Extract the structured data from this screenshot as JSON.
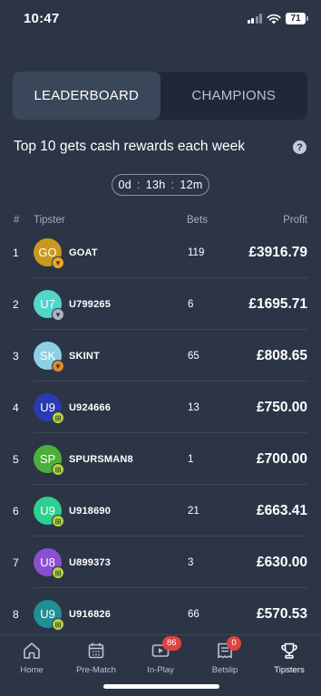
{
  "status_bar": {
    "time": "10:47",
    "battery": "71"
  },
  "tabs_segment": {
    "leaderboard": "LEADERBOARD",
    "champions": "CHAMPIONS"
  },
  "promo_text": "Top 10 gets cash rewards each week",
  "help_icon_glyph": "?",
  "countdown": {
    "days": "0d",
    "hours": "13h",
    "minutes": "12m",
    "separator": ":"
  },
  "table_headers": {
    "rank": "#",
    "tipster": "Tipster",
    "bets": "Bets",
    "profit": "Profit"
  },
  "rows": [
    {
      "rank": "1",
      "initials": "GO",
      "name": "GOAT",
      "bets": "119",
      "profit": "£3916.79",
      "avatar_color": "#c9991f",
      "badge": "gold-trophy",
      "badge_color": "#f0a524"
    },
    {
      "rank": "2",
      "initials": "U7",
      "name": "U799265",
      "bets": "6",
      "profit": "£1695.71",
      "avatar_color": "#52d6cc",
      "badge": "silver-trophy",
      "badge_color": "#aeb6c4"
    },
    {
      "rank": "3",
      "initials": "SK",
      "name": "SKINT",
      "bets": "65",
      "profit": "£808.65",
      "avatar_color": "#8fcfe4",
      "badge": "bronze-trophy",
      "badge_color": "#e08a2c"
    },
    {
      "rank": "4",
      "initials": "U9",
      "name": "U924666",
      "bets": "13",
      "profit": "£750.00",
      "avatar_color": "#2a3ab0",
      "badge": "cash-badge",
      "badge_color": "#b6d63c"
    },
    {
      "rank": "5",
      "initials": "SP",
      "name": "SPURSMAN8",
      "bets": "1",
      "profit": "£700.00",
      "avatar_color": "#4caf3a",
      "badge": "cash-badge",
      "badge_color": "#b6d63c"
    },
    {
      "rank": "6",
      "initials": "U9",
      "name": "U918690",
      "bets": "21",
      "profit": "£663.41",
      "avatar_color": "#2fcf8f",
      "badge": "cash-badge",
      "badge_color": "#b6d63c"
    },
    {
      "rank": "7",
      "initials": "U8",
      "name": "U899373",
      "bets": "3",
      "profit": "£630.00",
      "avatar_color": "#8a4fd0",
      "badge": "cash-badge",
      "badge_color": "#b6d63c"
    },
    {
      "rank": "8",
      "initials": "U9",
      "name": "U916826",
      "bets": "66",
      "profit": "£570.53",
      "avatar_color": "#1f8f96",
      "badge": "cash-badge",
      "badge_color": "#b6d63c"
    }
  ],
  "bottom_nav": [
    {
      "label": "Home",
      "icon": "home-icon"
    },
    {
      "label": "Pre-Match",
      "icon": "calendar-icon"
    },
    {
      "label": "In-Play",
      "icon": "video-icon",
      "badge": "86"
    },
    {
      "label": "Betslip",
      "icon": "betslip-icon",
      "badge": "0"
    },
    {
      "label": "Tipsters",
      "icon": "trophy-icon",
      "active": true
    }
  ],
  "colors": {
    "background": "#2b3546",
    "segment_bg": "#1f2838",
    "active_segment": "#3a4659",
    "badge_red": "#e0443e"
  }
}
